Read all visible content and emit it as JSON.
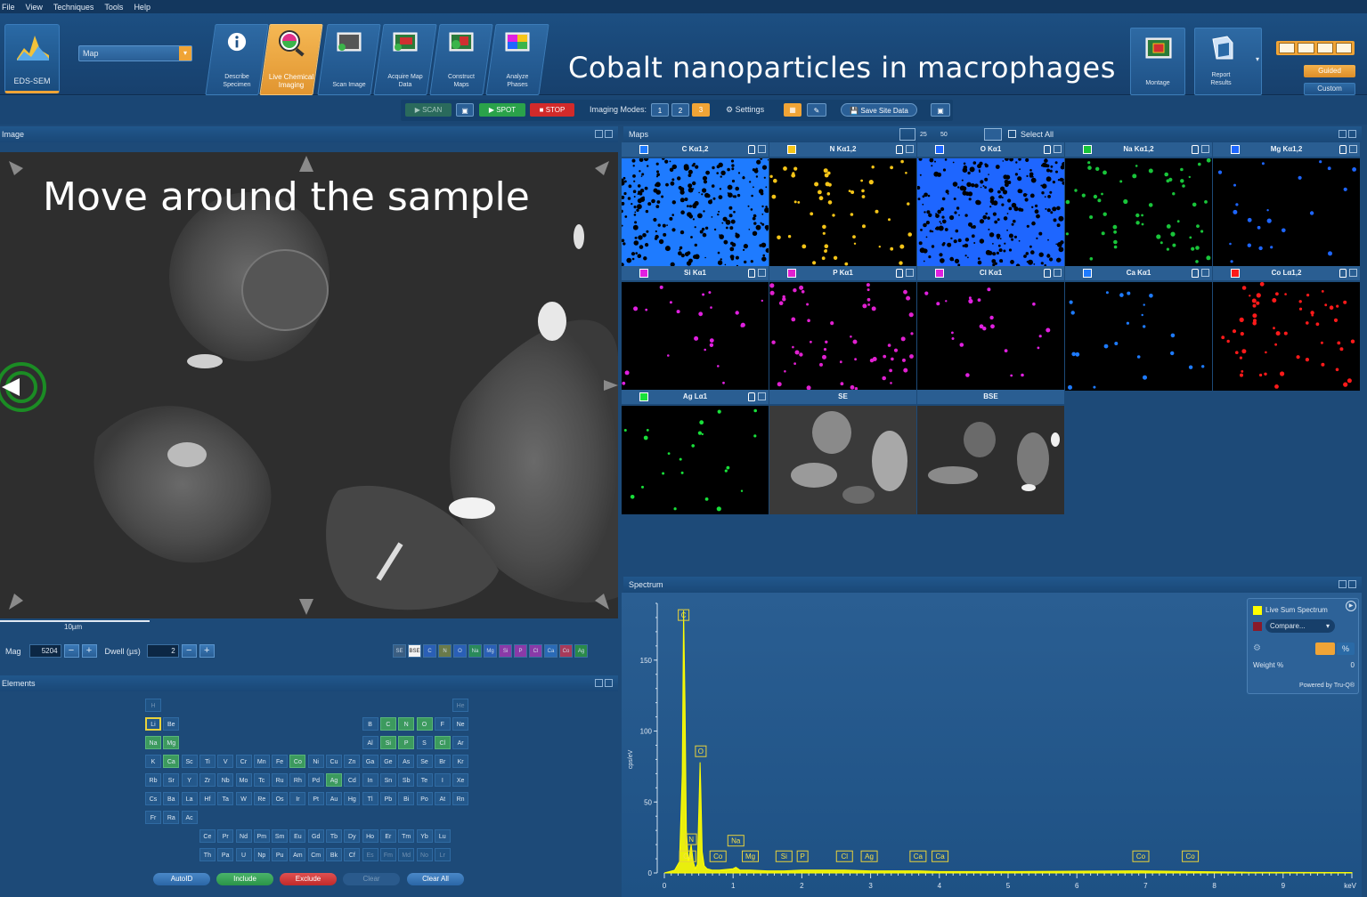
{
  "menu": [
    "File",
    "View",
    "Techniques",
    "Tools",
    "Help"
  ],
  "ribbon": {
    "app_tile": "EDS-SEM",
    "mode_select": "Map",
    "steps": [
      {
        "label": "Describe\nSpecimen",
        "icon": "info-icon"
      },
      {
        "label": "Live Chemical\nImaging",
        "icon": "magnifier-icon",
        "active": true
      },
      {
        "label": "Scan Image",
        "icon": "scan-image-icon"
      },
      {
        "label": "Acquire Map\nData",
        "icon": "acquire-map-icon"
      },
      {
        "label": "Construct\nMaps",
        "icon": "construct-maps-icon"
      },
      {
        "label": "Analyze\nPhases",
        "icon": "analyze-phases-icon"
      }
    ],
    "title": "Cobalt nanoparticles in macrophages",
    "montage": "Montage",
    "report": "Report\nResults",
    "guided": "Guided",
    "custom": "Custom"
  },
  "toolbar": {
    "scan": "SCAN",
    "spot": "SPOT",
    "stop": "STOP",
    "imaging_modes_label": "Imaging Modes:",
    "modes": [
      "1",
      "2",
      "3"
    ],
    "settings": "Settings",
    "save_site": "Save Site Data"
  },
  "image_panel": {
    "title": "Image",
    "overlay": "Move around the sample",
    "scale": "10µm",
    "mag_label": "Mag",
    "mag_value": "5204",
    "dwell_label": "Dwell (µs)",
    "dwell_value": "2",
    "chips": [
      "SE",
      "BSE",
      "C",
      "N",
      "O",
      "Na",
      "Mg",
      "Si",
      "P",
      "Cl",
      "Ca",
      "Co",
      "Ag"
    ]
  },
  "maps_panel": {
    "title": "Maps",
    "select_all": "Select All",
    "zoom_25": "25",
    "zoom_50": "50",
    "tiles": [
      {
        "label": "C Kα1,2",
        "color": "#1e7bff",
        "kind": "dense"
      },
      {
        "label": "N Kα1,2",
        "color": "#f5c518",
        "kind": "dots"
      },
      {
        "label": "O Kα1",
        "color": "#1e66ff",
        "kind": "dense"
      },
      {
        "label": "Na Kα1,2",
        "color": "#19c53a",
        "kind": "dots"
      },
      {
        "label": "Mg Kα1,2",
        "color": "#1e66ff",
        "kind": "sparse"
      },
      {
        "label": "Si Kα1",
        "color": "#e020e0",
        "kind": "sparse"
      },
      {
        "label": "P Kα1",
        "color": "#e020d0",
        "kind": "dots"
      },
      {
        "label": "Cl Kα1",
        "color": "#e020e0",
        "kind": "sparse"
      },
      {
        "label": "Ca Kα1",
        "color": "#1e7bff",
        "kind": "sparse"
      },
      {
        "label": "Co Lα1,2",
        "color": "#ff1a1a",
        "kind": "dots"
      },
      {
        "label": "Ag Lα1",
        "color": "#19e03a",
        "kind": "sparse"
      },
      {
        "label": "SE",
        "color": "#cccccc",
        "kind": "se"
      },
      {
        "label": "BSE",
        "color": "#cccccc",
        "kind": "bse"
      }
    ]
  },
  "elements_panel": {
    "title": "Elements",
    "buttons": [
      "AutoID",
      "Include",
      "Exclude",
      "Clear",
      "Clear All"
    ]
  },
  "spectrum_panel": {
    "title": "Spectrum",
    "legend_live": "Live Sum Spectrum",
    "compare": "Compare...",
    "weight_label": "Weight %",
    "weight_value": "0",
    "powered": "Powered by Tru-Q®",
    "percent_btn": "%"
  },
  "chart_data": {
    "type": "line",
    "xlabel": "keV",
    "ylabel": "cps/eV",
    "xlim": [
      0,
      10
    ],
    "ylim": [
      0,
      190
    ],
    "x_ticks": [
      0,
      1,
      2,
      3,
      4,
      5,
      6,
      7,
      8,
      9
    ],
    "y_ticks": [
      0,
      50,
      100,
      150
    ],
    "series": [
      {
        "name": "Live Sum Spectrum",
        "color": "#ffff00",
        "x": [
          0,
          0.15,
          0.22,
          0.26,
          0.28,
          0.3,
          0.32,
          0.35,
          0.39,
          0.42,
          0.45,
          0.48,
          0.51,
          0.52,
          0.53,
          0.55,
          0.58,
          0.62,
          0.7,
          0.8,
          1.0,
          1.04,
          1.1,
          1.25,
          1.5,
          1.74,
          2.0,
          2.62,
          2.98,
          3.69,
          4.0,
          5.0,
          6.93,
          7.65,
          8.5,
          10
        ],
        "y": [
          0,
          2,
          8,
          70,
          185,
          120,
          30,
          8,
          20,
          8,
          3,
          6,
          60,
          78,
          60,
          15,
          5,
          3,
          2,
          2,
          3,
          4,
          2,
          2,
          1.5,
          1.5,
          2,
          2,
          1.5,
          1.5,
          1,
          1,
          1.5,
          1,
          0.5,
          0.3
        ]
      }
    ],
    "peak_labels": [
      {
        "label": "C",
        "x": 0.28,
        "y": 178
      },
      {
        "label": "O",
        "x": 0.53,
        "y": 82
      },
      {
        "label": "N",
        "x": 0.39,
        "y": 20
      },
      {
        "label": "Na",
        "x": 1.04,
        "y": 19
      },
      {
        "label": "Ca",
        "x": 0.34,
        "y": 8
      },
      {
        "label": "Co",
        "x": 0.78,
        "y": 8
      },
      {
        "label": "Mg",
        "x": 1.25,
        "y": 8
      },
      {
        "label": "Si",
        "x": 1.74,
        "y": 8
      },
      {
        "label": "P",
        "x": 2.01,
        "y": 8
      },
      {
        "label": "Cl",
        "x": 2.62,
        "y": 8
      },
      {
        "label": "Ag",
        "x": 2.98,
        "y": 8
      },
      {
        "label": "Ca",
        "x": 3.69,
        "y": 8
      },
      {
        "label": "Ca",
        "x": 4.01,
        "y": 8
      },
      {
        "label": "Co",
        "x": 6.93,
        "y": 8
      },
      {
        "label": "Co",
        "x": 7.65,
        "y": 8
      }
    ]
  }
}
